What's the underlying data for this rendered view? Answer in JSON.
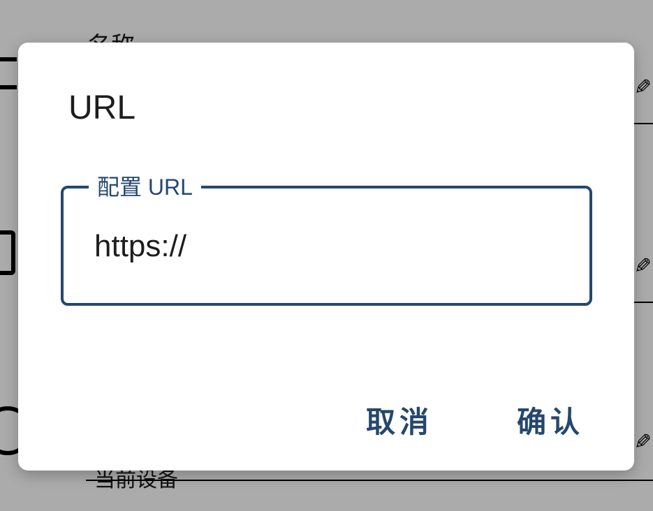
{
  "background": {
    "label_top": "名称",
    "label_bottom": "当前设备",
    "icons": [
      "list-icon",
      "document-icon",
      "power-icon",
      "pencil-icon"
    ]
  },
  "dialog": {
    "title": "URL",
    "field": {
      "label": "配置 URL",
      "value": "https://"
    },
    "cancel_label": "取消",
    "confirm_label": "确认"
  },
  "colors": {
    "accent": "#25476e",
    "scrim": "#ababab",
    "surface": "#ffffff"
  }
}
